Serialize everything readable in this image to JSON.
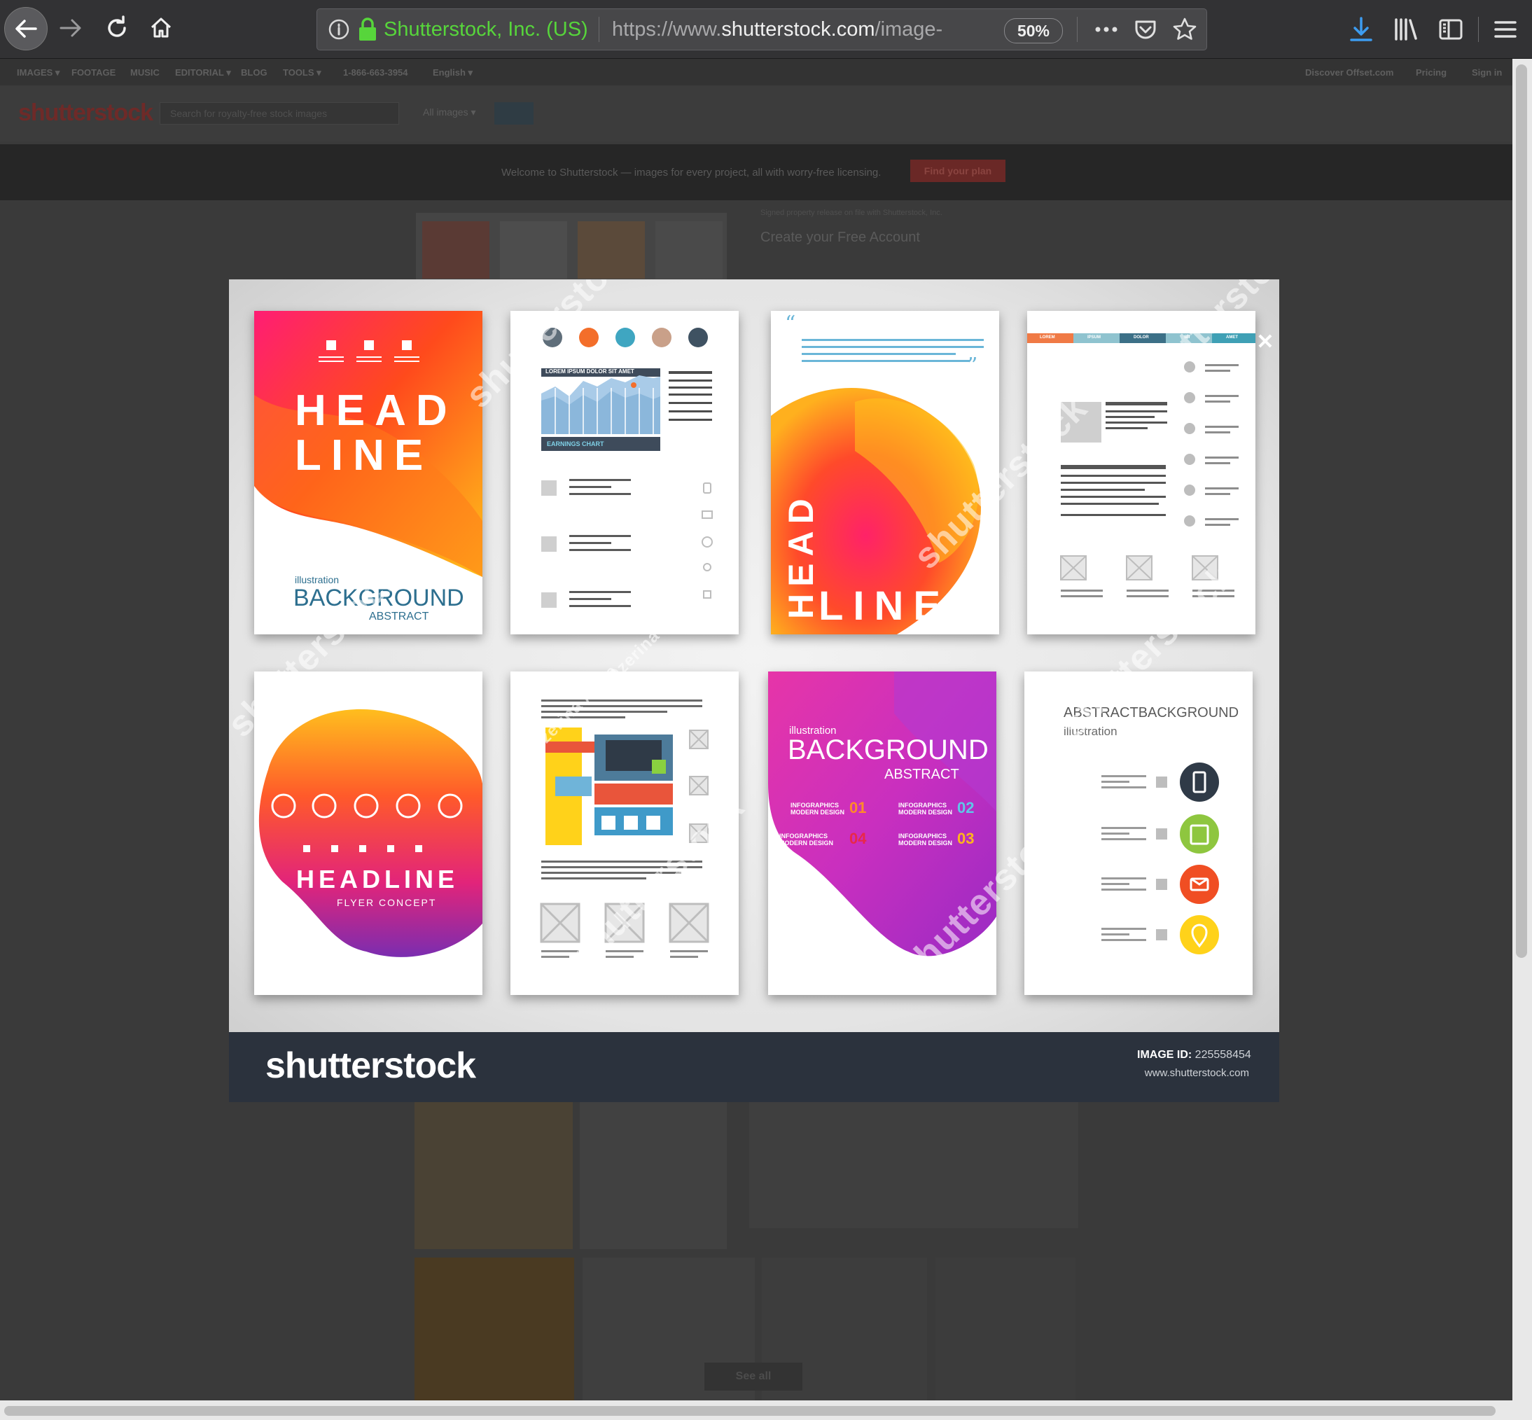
{
  "browser": {
    "site_identity": "Shutterstock, Inc. (US)",
    "url_prefix": "https://www.",
    "url_domain": "shutterstock.com",
    "url_path": "/image-",
    "zoom": "50%"
  },
  "site_nav": {
    "items": [
      "IMAGES ▾",
      "FOOTAGE",
      "MUSIC",
      "EDITORIAL ▾",
      "BLOG",
      "TOOLS ▾",
      "1-866-663-3954",
      "English ▾"
    ],
    "right": [
      "Discover Offset.com",
      "Pricing",
      "Sign in"
    ]
  },
  "header": {
    "logo": "shutterstock",
    "search_placeholder": "Search for royalty-free stock images",
    "filter": "All images ▾"
  },
  "promo": {
    "text": "Welcome to Shutterstock — images for every project, all with worry-free licensing.",
    "button": "Find your plan"
  },
  "background_page": {
    "release_note": "Signed property release on file with Shutterstock, Inc.",
    "create_account": "Create your Free Account",
    "see_all": "See all"
  },
  "modal": {
    "footer_logo": "shutterstock",
    "image_id_label": "IMAGE ID:",
    "image_id": "225558454",
    "site_url": "www.shutterstock.com"
  },
  "cards": {
    "c1": {
      "line1": "HEAD",
      "line2": "LINE",
      "small": "illustration",
      "big": "BACKGROUND",
      "sub": "ABSTRACT"
    },
    "c2": {
      "banner": "LOREM IPSUM DOLOR SIT AMET",
      "chart_label": "EARNINGS CHART"
    },
    "c3": {
      "line1": "HEAD",
      "line2": "LINE"
    },
    "c4": {
      "tabs": [
        "LOREM",
        "IPSUM",
        "DOLOR",
        "SIT",
        "AMET"
      ]
    },
    "c5": {
      "title": "HEADLINE",
      "sub": "FLYER CONCEPT"
    },
    "c7": {
      "small": "illustration",
      "big": "BACKGROUND",
      "sub": "ABSTRACT",
      "info_label": "INFOGRAPHICS",
      "info_sub": "MODERN DESIGN",
      "n1": "01",
      "n2": "02",
      "n3": "03",
      "n4": "04"
    },
    "c8": {
      "title_a": "ABSTRACT",
      "title_b": "BACKGROUND",
      "small": "illustration"
    }
  },
  "watermarks": {
    "brand": "shutterstock",
    "author": "Ozerina Anna"
  },
  "colors": {
    "accent_green": "#57d53b",
    "footer_bg": "#2b323d",
    "download_blue": "#3d9cf0"
  }
}
